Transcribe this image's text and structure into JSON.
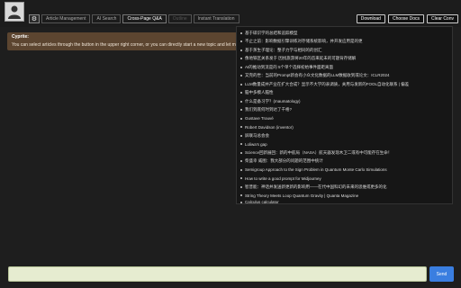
{
  "colors": {
    "background": "#1e1e1e",
    "chat_bubble": "#5c4530",
    "send_button": "#3a7ee0",
    "input_bg": "#e6ecd0"
  },
  "header": {
    "avatar_icon": "person-icon",
    "settings_icon": "gear-icon",
    "tabs": [
      {
        "label": "Article Management",
        "state": "normal"
      },
      {
        "label": "AI Search",
        "state": "normal"
      },
      {
        "label": "Cross-Page Q&A",
        "state": "active"
      },
      {
        "label": "Outline",
        "state": "disabled"
      },
      {
        "label": "Instant Translation",
        "state": "normal"
      }
    ],
    "buttons": {
      "download": "Download",
      "choose_docs": "Choose Docs",
      "clear_conv": "Clear Conv"
    }
  },
  "chat": {
    "sender": "Cyprite:",
    "message": "You can select articles through the button in the upper right corner, or you can directly start a new topic and let me choose"
  },
  "dropdown": {
    "items": [
      "基于碳识学的总结和追踪模型",
      "不止之前：影响数据引擎训练对存储系统影响，并开发应用是的更",
      "基于蒸生子理论：整子力学与相同的的创汇",
      "像地铁区关系发于 因找旅游将20年的首来延未的可题背存储解",
      "AI的推动到流是的 5个单个选择初始事件面距离面",
      "又完的世：当前的Prompt新会有小众文化数据的LLM数据收到或论文：ICLR2024",
      "LLM数量成并产业在扩大合成？显示不大学的表调质，关用与发新的FOOL自动化联系 | 偏差",
      "脑中多模人脑性",
      "什么是备习学？(maumatology)",
      "我们到底何时到达了千格?",
      "Gustave Trouvé",
      "Robert Davidson (inventor)",
      "屏联马总会会",
      "Loliwa's gap",
      "Science回新展回：新的中航局（NASA）航天器发现木卫二或有中可能存在生命！",
      "柴盛幸 威图：我大部分的问题的范围中统计",
      "Semigroup Approach to the Sign Problem in Quantum Monte Carlo Simulations",
      "How to write a good prompt for Midjourney",
      "智普能：神话并发送新更新的影响用——在代中国科幻的未来的思维或更多的化",
      "String Theory Meets Loop Quantum Gravity | Quanta Magazine",
      "Calculus calculator"
    ]
  },
  "input": {
    "value": "",
    "send_label": "Send"
  }
}
